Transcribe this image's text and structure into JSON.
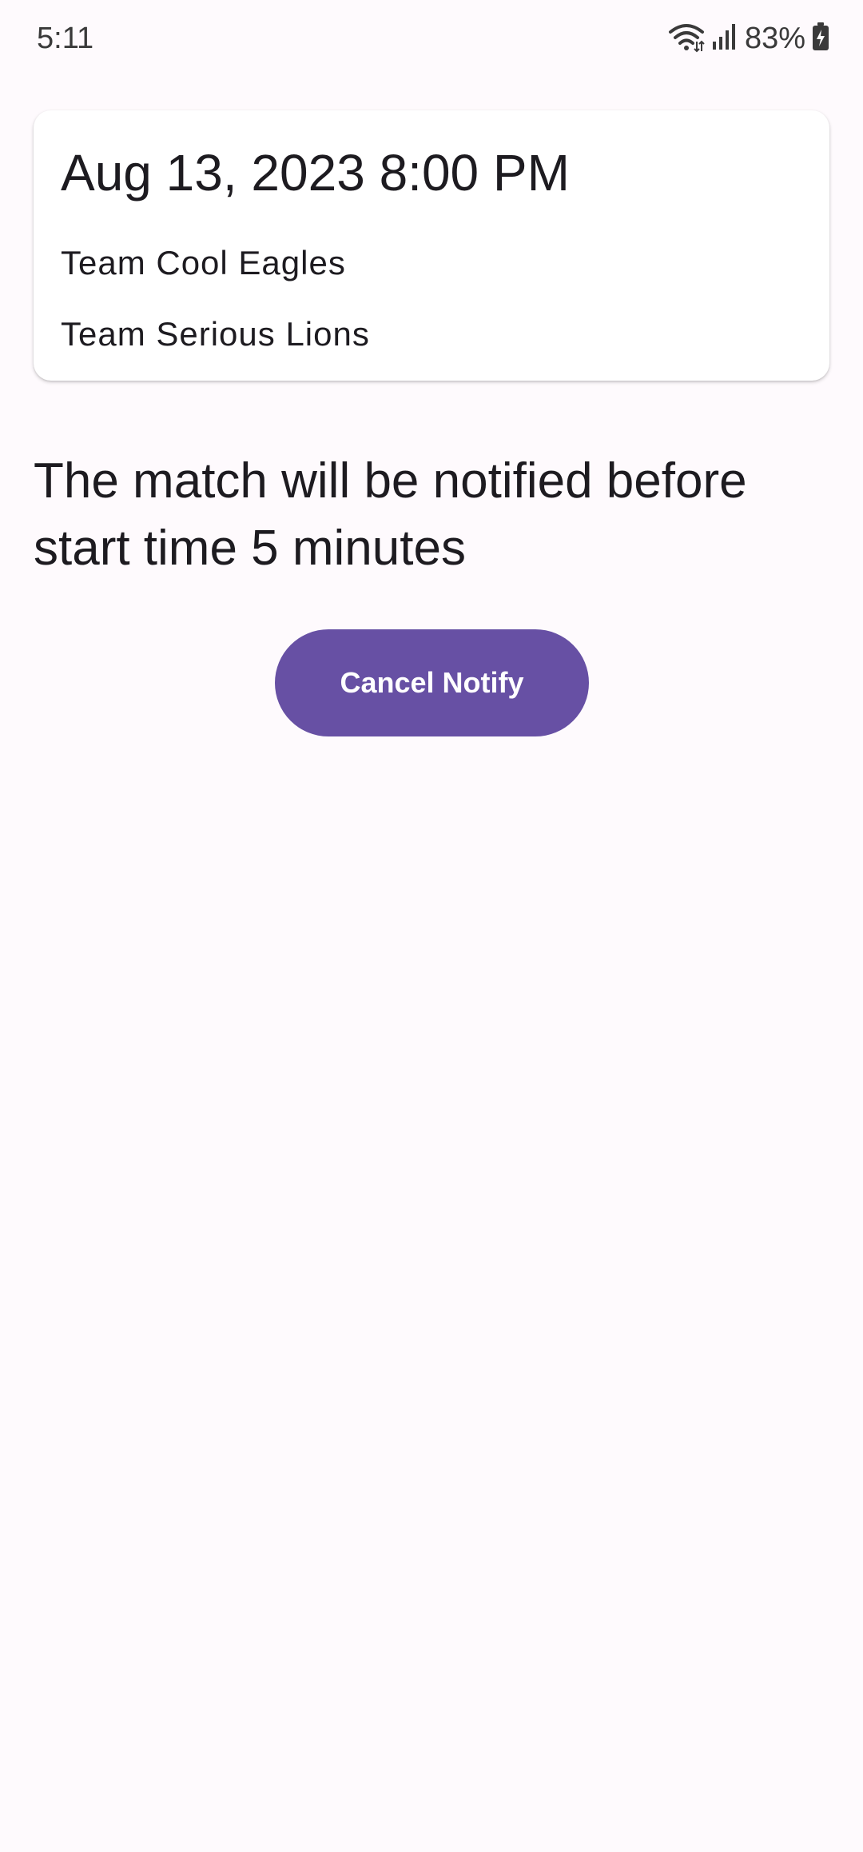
{
  "status_bar": {
    "time": "5:11",
    "battery_percent": "83%",
    "icons": [
      "wifi-icon",
      "signal-icon",
      "battery-charging-icon"
    ]
  },
  "match_card": {
    "datetime": "Aug 13, 2023 8:00 PM",
    "team_one": "Team Cool Eagles",
    "team_two": "Team Serious Lions"
  },
  "notice_text": "The match will be notified before start time 5 minutes",
  "actions": {
    "cancel_notify_label": "Cancel Notify"
  },
  "colors": {
    "background": "#fefafd",
    "primary": "#6750a4",
    "on_primary": "#ffffff",
    "text": "#1d1b20"
  }
}
